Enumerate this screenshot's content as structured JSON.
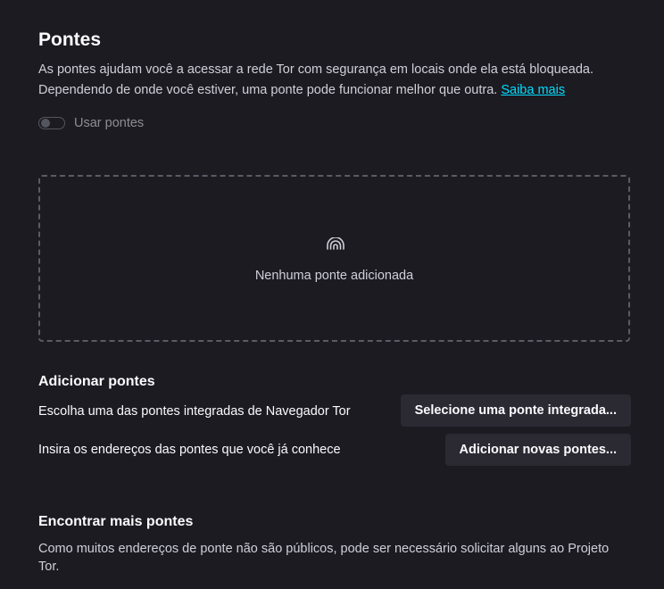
{
  "bridges": {
    "title": "Pontes",
    "description": "As pontes ajudam você a acessar a rede Tor com segurança em locais onde ela está bloqueada. Dependendo de onde você estiver, uma ponte pode funcionar melhor que outra.",
    "learn_more": "Saiba mais",
    "toggle": {
      "label": "Usar pontes",
      "checked": false,
      "disabled": true
    },
    "empty_state": {
      "icon": "bridge-icon",
      "text": "Nenhuma ponte adicionada"
    }
  },
  "add_bridges": {
    "heading": "Adicionar pontes",
    "builtin_label": "Escolha uma das pontes integradas de Navegador Tor",
    "builtin_button": "Selecione uma ponte integrada...",
    "manual_label": "Insira os endereços das pontes que você já conhece",
    "manual_button": "Adicionar novas pontes..."
  },
  "find_bridges": {
    "heading": "Encontrar mais pontes",
    "description": "Como muitos endereços de ponte não são públicos, pode ser necessário solicitar alguns ao Projeto Tor."
  },
  "colors": {
    "background": "#1c1b22",
    "button_background": "#2b2a33",
    "link": "#00ddff",
    "text": "#fbfbfe",
    "secondary_text": "#cfcfd8"
  }
}
